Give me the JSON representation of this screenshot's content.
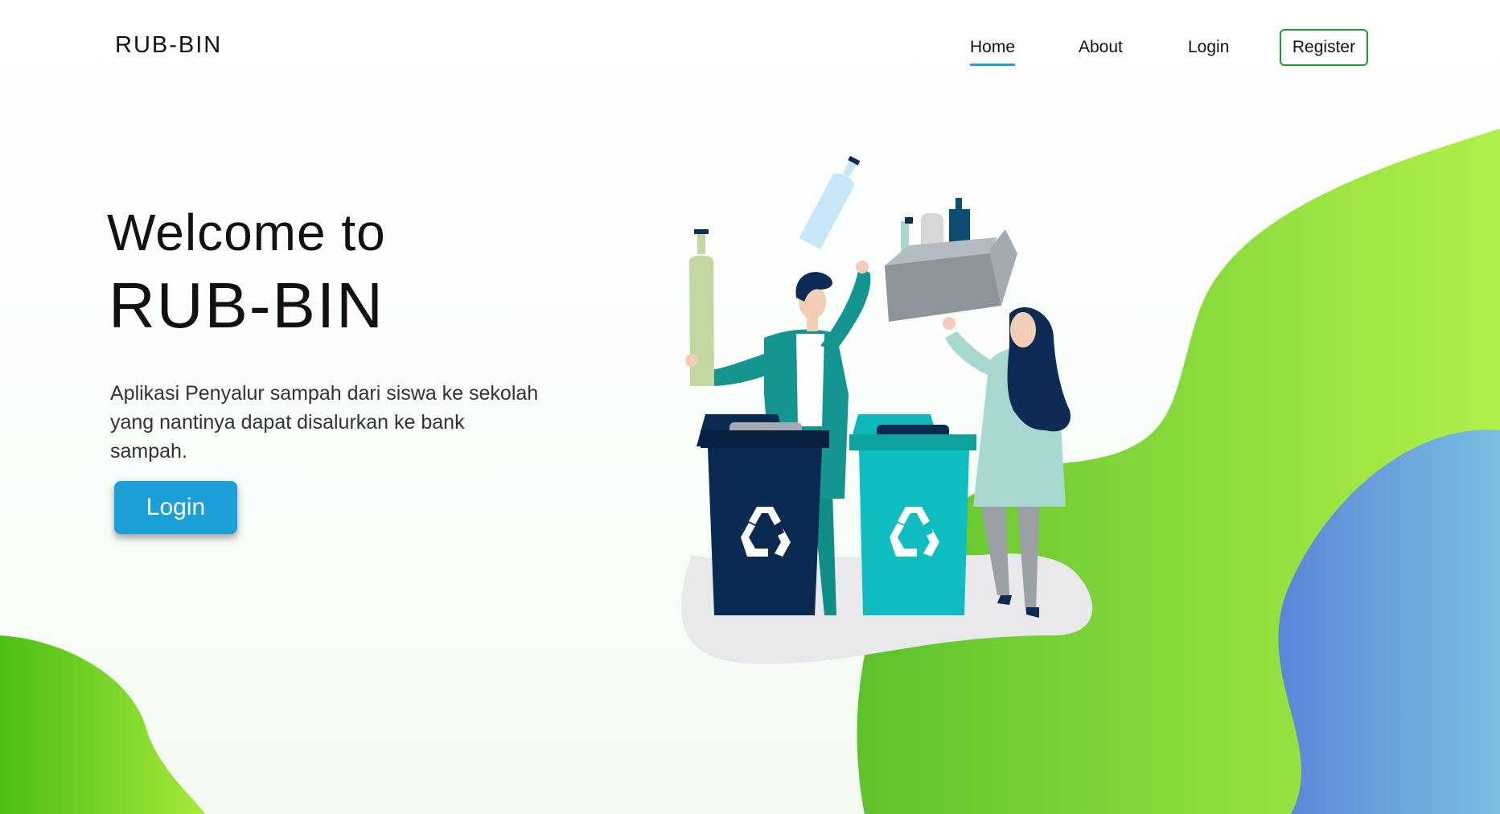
{
  "nav": {
    "brand": "RUB-BIN",
    "links": [
      "Home",
      "About",
      "Login"
    ],
    "register": "Register"
  },
  "hero": {
    "welcome": "Welcome to",
    "title": "RUB-BIN",
    "description": "Aplikasi Penyalur sampah dari siswa ke sekolah yang nantinya dapat disalurkan ke bank sampah.",
    "login_button": "Login"
  },
  "colors": {
    "accent_blue": "#1ba0d8",
    "register_border": "#1c9a35",
    "blob_green": "#8ee043",
    "blob_blue": "#5f8fd8"
  },
  "illustration": {
    "icons": [
      "bottle-icon",
      "recycle-icon",
      "trash-bin-icon",
      "cardboard-box-icon"
    ]
  }
}
